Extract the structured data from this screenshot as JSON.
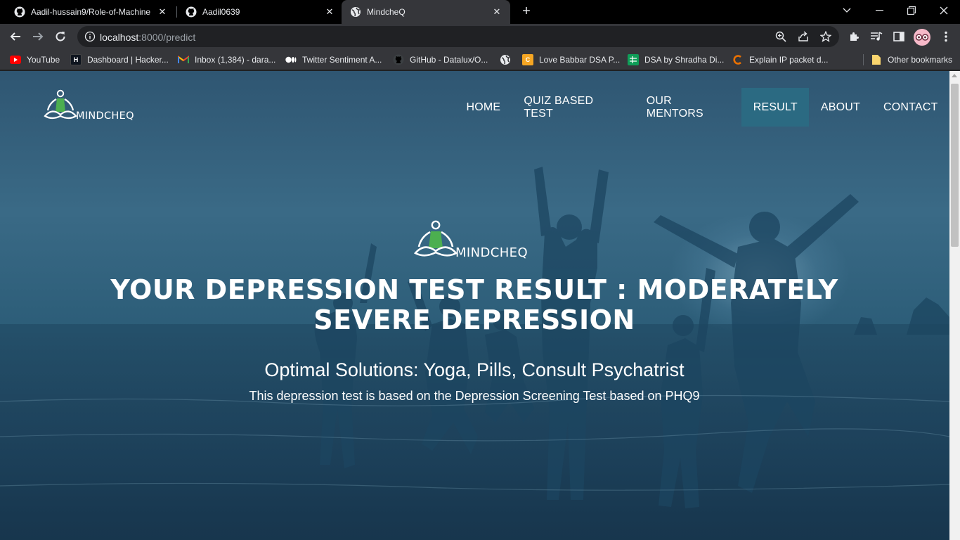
{
  "browser": {
    "tabs": [
      {
        "title": "Aadil-hussain9/Role-of-Machine",
        "icon": "github-icon",
        "active": false
      },
      {
        "title": "Aadil0639",
        "icon": "github-icon",
        "active": false
      },
      {
        "title": "MindcheQ",
        "icon": "globe-icon",
        "active": true
      }
    ],
    "new_tab": "+",
    "url_host": "localhost",
    "url_path": ":8000/predict",
    "bookmarks": [
      {
        "label": "YouTube",
        "icon": "youtube-icon"
      },
      {
        "label": "Dashboard | Hacker...",
        "icon": "hackerrank-icon"
      },
      {
        "label": "Inbox (1,384) - dara...",
        "icon": "gmail-icon"
      },
      {
        "label": "Twitter Sentiment A...",
        "icon": "medium-icon"
      },
      {
        "label": "GitHub - Datalux/O...",
        "icon": "github-icon"
      },
      {
        "label": "",
        "icon": "globe-icon"
      },
      {
        "label": "Love Babbar DSA P...",
        "icon": "codestudio-icon"
      },
      {
        "label": "DSA by Shradha Di...",
        "icon": "sheets-icon"
      },
      {
        "label": "Explain IP packet d...",
        "icon": "chegg-icon"
      },
      {
        "label": "Other bookmarks",
        "icon": "folder-icon"
      }
    ]
  },
  "site": {
    "brand": "MINDCHEQ",
    "nav": [
      {
        "label": "HOME",
        "active": false
      },
      {
        "label": "QUIZ BASED TEST",
        "active": false
      },
      {
        "label": "OUR MENTORS",
        "active": false
      },
      {
        "label": "RESULT",
        "active": true
      },
      {
        "label": "ABOUT",
        "active": false
      },
      {
        "label": "CONTACT",
        "active": false
      }
    ],
    "hero": {
      "title": "YOUR DEPRESSION TEST RESULT : MODERATELY SEVERE DEPRESSION",
      "subtitle": "Optimal Solutions: Yoga, Pills, Consult Psychatrist",
      "note": "This depression test is based on the Depression Screening Test based on PHQ9"
    }
  },
  "colors": {
    "nav_active": "#2b6a82",
    "logo_green": "#4caf50",
    "chrome_dark": "#35363a"
  }
}
